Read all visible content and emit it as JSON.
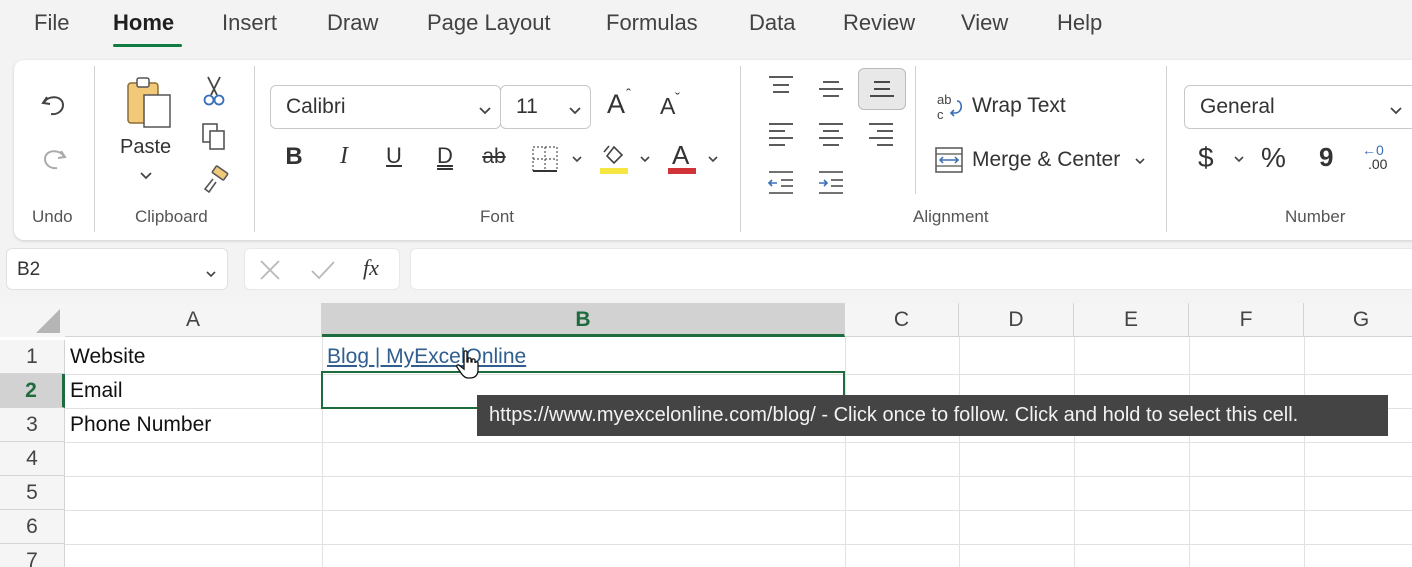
{
  "tabs": [
    {
      "label": "File"
    },
    {
      "label": "Home"
    },
    {
      "label": "Insert"
    },
    {
      "label": "Draw"
    },
    {
      "label": "Page Layout"
    },
    {
      "label": "Formulas"
    },
    {
      "label": "Data"
    },
    {
      "label": "Review"
    },
    {
      "label": "View"
    },
    {
      "label": "Help"
    }
  ],
  "ribbon": {
    "undo_group": "Undo",
    "clipboard_group": "Clipboard",
    "paste_label": "Paste",
    "font_group": "Font",
    "font_name": "Calibri",
    "font_size": "11",
    "bold": "B",
    "italic": "I",
    "underline": "U",
    "double_underline": "D",
    "strikethrough": "ab",
    "font_color_letter": "A",
    "grow_font": "A",
    "shrink_font": "A",
    "alignment_group": "Alignment",
    "wrap_text": "Wrap Text",
    "merge_center": "Merge & Center",
    "number_group": "Number",
    "number_format": "General",
    "currency": "$",
    "percent": "%",
    "comma": "9",
    "increase_decimal_top": "←0",
    "increase_decimal_bottom": ".00",
    "highlight_color": "#f5e642",
    "font_color": "#d13438"
  },
  "formula_bar": {
    "name_box": "B2",
    "fx": "fx",
    "formula": ""
  },
  "sheet": {
    "columns": [
      "A",
      "B",
      "C",
      "D",
      "E",
      "F",
      "G"
    ],
    "selected_column": "B",
    "rows": [
      "1",
      "2",
      "3",
      "4",
      "5",
      "6",
      "7"
    ],
    "selected_row": "2",
    "cells": {
      "A1": "Website",
      "B1": "Blog | MyExcelOnline",
      "A2": "Email",
      "A3": "Phone Number"
    },
    "active_cell": "B2"
  },
  "tooltip": "https://www.myexcelonline.com/blog/ - Click once to follow. Click and hold to select this cell.",
  "colors": {
    "accent_green": "#1e6b3d",
    "link_blue": "#2f5e8f",
    "tooltip_bg": "#444444"
  }
}
